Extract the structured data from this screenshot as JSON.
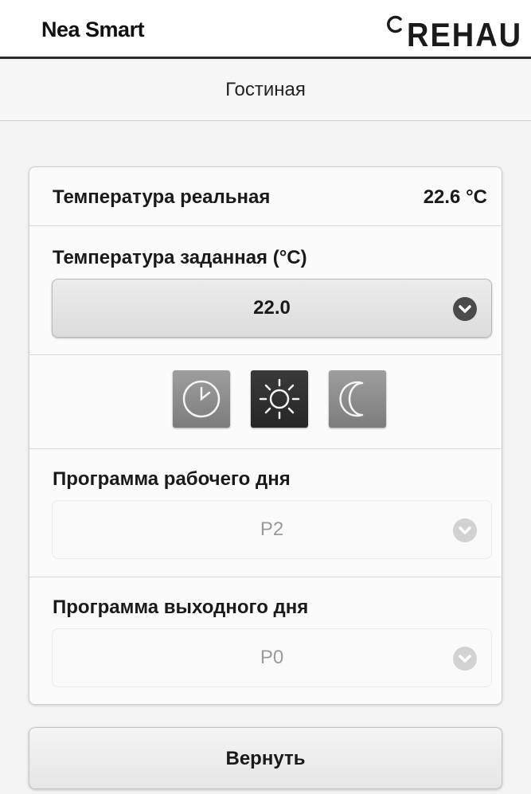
{
  "header": {
    "app_title": "Nea Smart",
    "brand_logo_text": "REHAU"
  },
  "room": {
    "title": "Гостиная"
  },
  "actual_temperature": {
    "label": "Температура реальная",
    "value": "22.6 °C"
  },
  "set_temperature": {
    "label": "Температура заданная (°C)",
    "selected": "22.0"
  },
  "modes": [
    {
      "name": "clock-icon",
      "active": false
    },
    {
      "name": "sun-icon",
      "active": true
    },
    {
      "name": "moon-icon",
      "active": false
    }
  ],
  "workday_program": {
    "label": "Программа рабочего дня",
    "selected": "P2"
  },
  "weekend_program": {
    "label": "Программа выходного дня",
    "selected": "P0"
  },
  "return_button": {
    "label": "Вернуть"
  },
  "colors": {
    "active_mode": "#2e2e2e",
    "inactive_mode": "#8c8c8c",
    "disabled_text": "#9a9a9a"
  }
}
